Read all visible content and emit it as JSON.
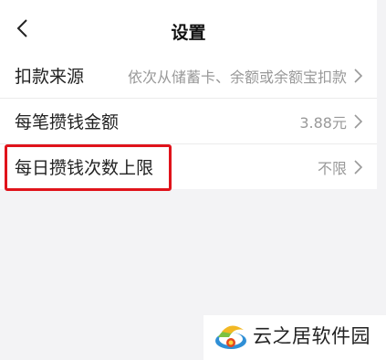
{
  "header": {
    "title": "设置",
    "back_icon": "chevron-left-icon"
  },
  "settings": {
    "rows": [
      {
        "label": "扣款来源",
        "value": "依次从储蓄卡、余额或余额宝扣款"
      },
      {
        "label": "每笔攒钱金额",
        "value": "3.88元"
      },
      {
        "label": "每日攒钱次数上限",
        "value": "不限"
      }
    ],
    "chevron_icon": "chevron-right-icon"
  },
  "highlight": {
    "color": "#e0131b"
  },
  "watermark": {
    "text": "云之居软件园",
    "logo_icon": "yunzhiju-logo-icon"
  }
}
